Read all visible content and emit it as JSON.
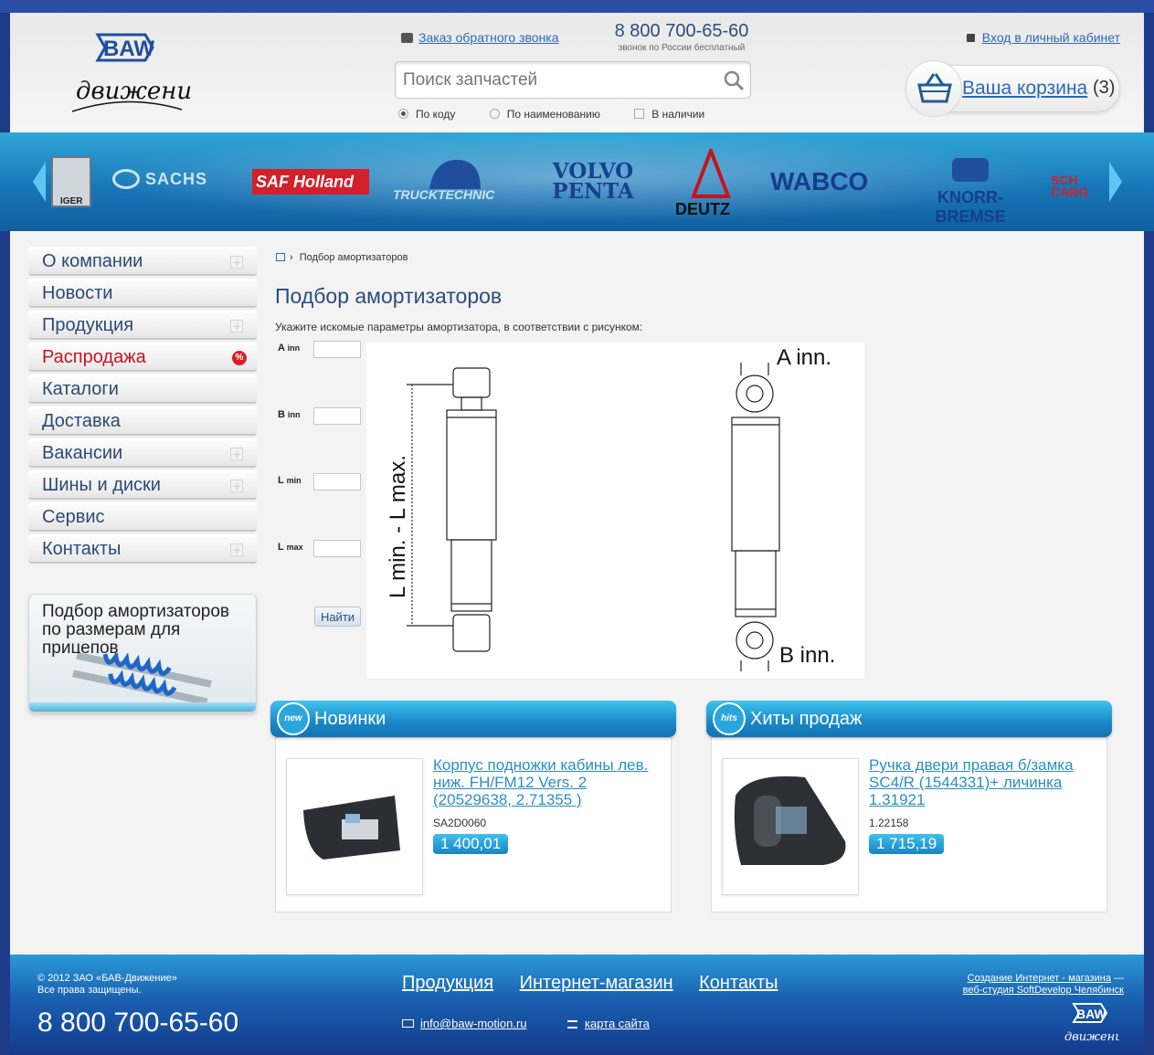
{
  "header": {
    "callback_label": "Заказ обратного звонка",
    "phone": "8 800 700-65-60",
    "phone_note": "звонок по России бесплатный",
    "login_label": "Вход в личный кабинет",
    "search_placeholder": "Поиск запчастей",
    "search_options": [
      "По коду",
      "По наименованию",
      "В наличии"
    ],
    "cart_label": "Ваша корзина",
    "cart_count": "(3)",
    "logo_text": "BAW",
    "logo_script": "движение"
  },
  "brands": [
    "IGER",
    "SACHS",
    "SAF Holland",
    "TRUCKTECHNIC",
    "VOLVO PENTA",
    "DEUTZ",
    "WABCO",
    "KNORR-BREMSE",
    "SCH CARG"
  ],
  "menu": [
    {
      "label": "О компании",
      "expandable": true
    },
    {
      "label": "Новости",
      "expandable": false
    },
    {
      "label": "Продукция",
      "expandable": true
    },
    {
      "label": "Распродажа",
      "expandable": false,
      "badge": "%"
    },
    {
      "label": "Каталоги",
      "expandable": false
    },
    {
      "label": "Доставка",
      "expandable": false
    },
    {
      "label": "Вакансии",
      "expandable": true
    },
    {
      "label": "Шины и диски",
      "expandable": true
    },
    {
      "label": "Сервис",
      "expandable": false
    },
    {
      "label": "Контакты",
      "expandable": true
    }
  ],
  "promo": {
    "text": "Подбор амортизаторов по размерам для прицепов"
  },
  "content": {
    "breadcrumb": "Подбор амортизаторов",
    "title": "Подбор амортизаторов",
    "intro": "Укажите искомые параметры амортизатора, в соответствии с рисунком:",
    "params": [
      {
        "label": "A",
        "sub": "inn"
      },
      {
        "label": "B",
        "sub": "inn"
      },
      {
        "label": "L",
        "sub": "min"
      },
      {
        "label": "L",
        "sub": "max"
      }
    ],
    "find_button": "Найти",
    "drawing_labels": {
      "length": "L min. - L max.",
      "top": "A inn.",
      "bottom": "B inn."
    }
  },
  "new_panel": {
    "title": "Новинки",
    "badge": "new",
    "product": {
      "name": "Корпус подножки кабины лев. ниж. FH/FM12 Vers. 2 (20529638, 2.71355 )",
      "code": "SA2D0060",
      "price": "1 400,01"
    }
  },
  "hits_panel": {
    "title": "Хиты продаж",
    "badge": "hits",
    "product": {
      "name": "Ручка двери правая б/замка SC4/R (1544331)+ личинка 1.31921",
      "code": "1.22158",
      "price": "1 715,19"
    }
  },
  "footer": {
    "copyright": "© 2012 ЗАО «БАВ-Движение»",
    "rights": "Все права защищены.",
    "phone": "8 800 700-65-60",
    "links": [
      "Продукция",
      "Интернет-магазин",
      "Контакты"
    ],
    "email": "info@baw-motion.ru",
    "sitemap": "карта сайта",
    "studio_line1": "Создание Интернет - магазина",
    "studio_dash": " —",
    "studio_line2": "веб-студия SoftDevelop Челябинск"
  }
}
